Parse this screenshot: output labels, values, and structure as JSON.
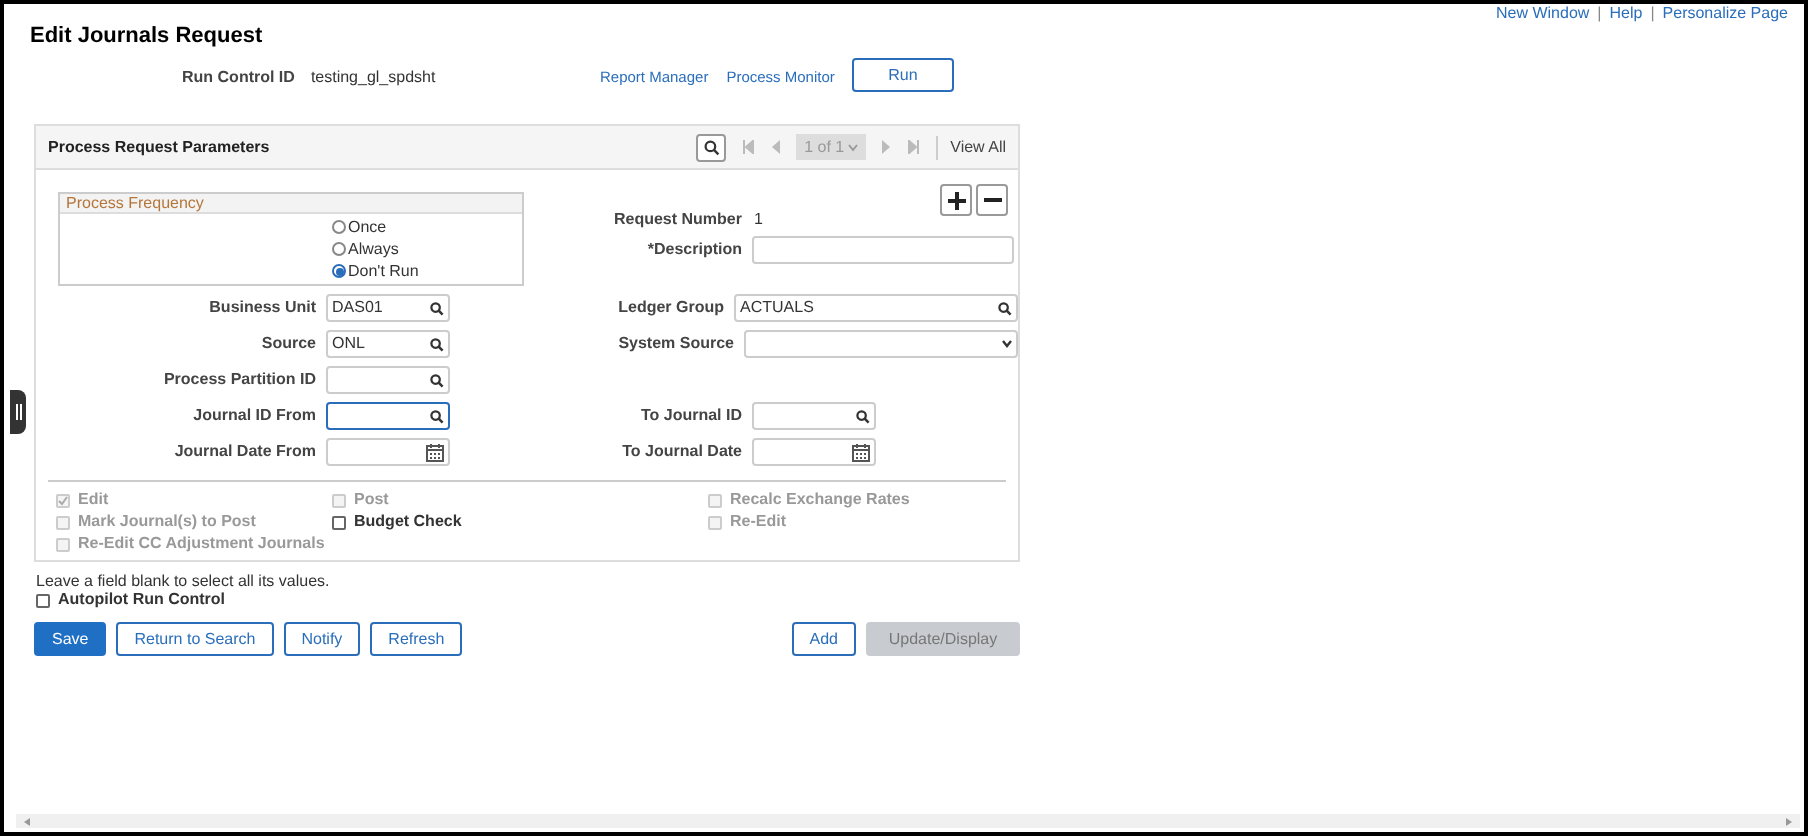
{
  "top_links": [
    "New Window",
    "Help",
    "Personalize Page"
  ],
  "top_link_separator": "|",
  "page_title": "Edit Journals Request",
  "run_control": {
    "label": "Run Control ID",
    "value": "testing_gl_spdsht"
  },
  "header_links": [
    "Report Manager",
    "Process Monitor"
  ],
  "run_button": "Run",
  "panel": {
    "title": "Process Request Parameters",
    "pager": "1 of 1",
    "view_all": "View All",
    "frequency": {
      "title": "Process Frequency",
      "options": [
        {
          "label": "Once",
          "selected": false
        },
        {
          "label": "Always",
          "selected": false
        },
        {
          "label": "Don't Run",
          "selected": true
        }
      ]
    },
    "request_number": {
      "label": "Request Number",
      "value": "1"
    },
    "description": {
      "label": "*Description"
    },
    "field_rows": [
      {
        "left": {
          "label": "Business Unit",
          "value": "DAS01",
          "kind": "lookup",
          "focused": false
        },
        "right": {
          "label": "Ledger Group",
          "value": "ACTUALS",
          "kind": "lookup-wide",
          "focused": false
        }
      },
      {
        "left": {
          "label": "Source",
          "value": "ONL",
          "kind": "lookup",
          "focused": false
        },
        "right": {
          "label": "System Source",
          "kind": "select",
          "focused": false
        }
      },
      {
        "left": {
          "label": "Process Partition ID",
          "kind": "lookup",
          "focused": false
        }
      },
      {
        "left": {
          "label": "Journal ID From",
          "kind": "lookup",
          "focused": true
        },
        "right": {
          "label": "To Journal ID",
          "kind": "lookup",
          "focused": false
        }
      },
      {
        "left": {
          "label": "Journal Date From",
          "kind": "date",
          "focused": false
        },
        "right": {
          "label": "To Journal Date",
          "kind": "date",
          "focused": false
        }
      }
    ],
    "options": [
      {
        "label": "Edit",
        "checked": true,
        "disabled": true
      },
      {
        "label": "Post",
        "checked": false,
        "disabled": true
      },
      {
        "label": "Recalc Exchange Rates",
        "checked": false,
        "disabled": true
      },
      {
        "label": "Mark Journal(s) to Post",
        "checked": false,
        "disabled": true
      },
      {
        "label": "Budget Check",
        "checked": false,
        "disabled": false
      },
      {
        "label": "Re-Edit",
        "checked": false,
        "disabled": true
      },
      {
        "label": "Re-Edit CC Adjustment Journals",
        "checked": false,
        "disabled": true
      }
    ]
  },
  "hint": "Leave a field blank to select all its values.",
  "autopilot": {
    "label": "Autopilot Run Control",
    "checked": false
  },
  "buttons": [
    {
      "label": "Save",
      "kind": "primary"
    },
    {
      "label": "Return to Search",
      "kind": "secondary"
    },
    {
      "label": "Notify",
      "kind": "secondary"
    },
    {
      "label": "Refresh",
      "kind": "secondary"
    },
    {
      "label": "Add",
      "kind": "secondary-right"
    },
    {
      "label": "Update/Display",
      "kind": "disabled"
    }
  ]
}
